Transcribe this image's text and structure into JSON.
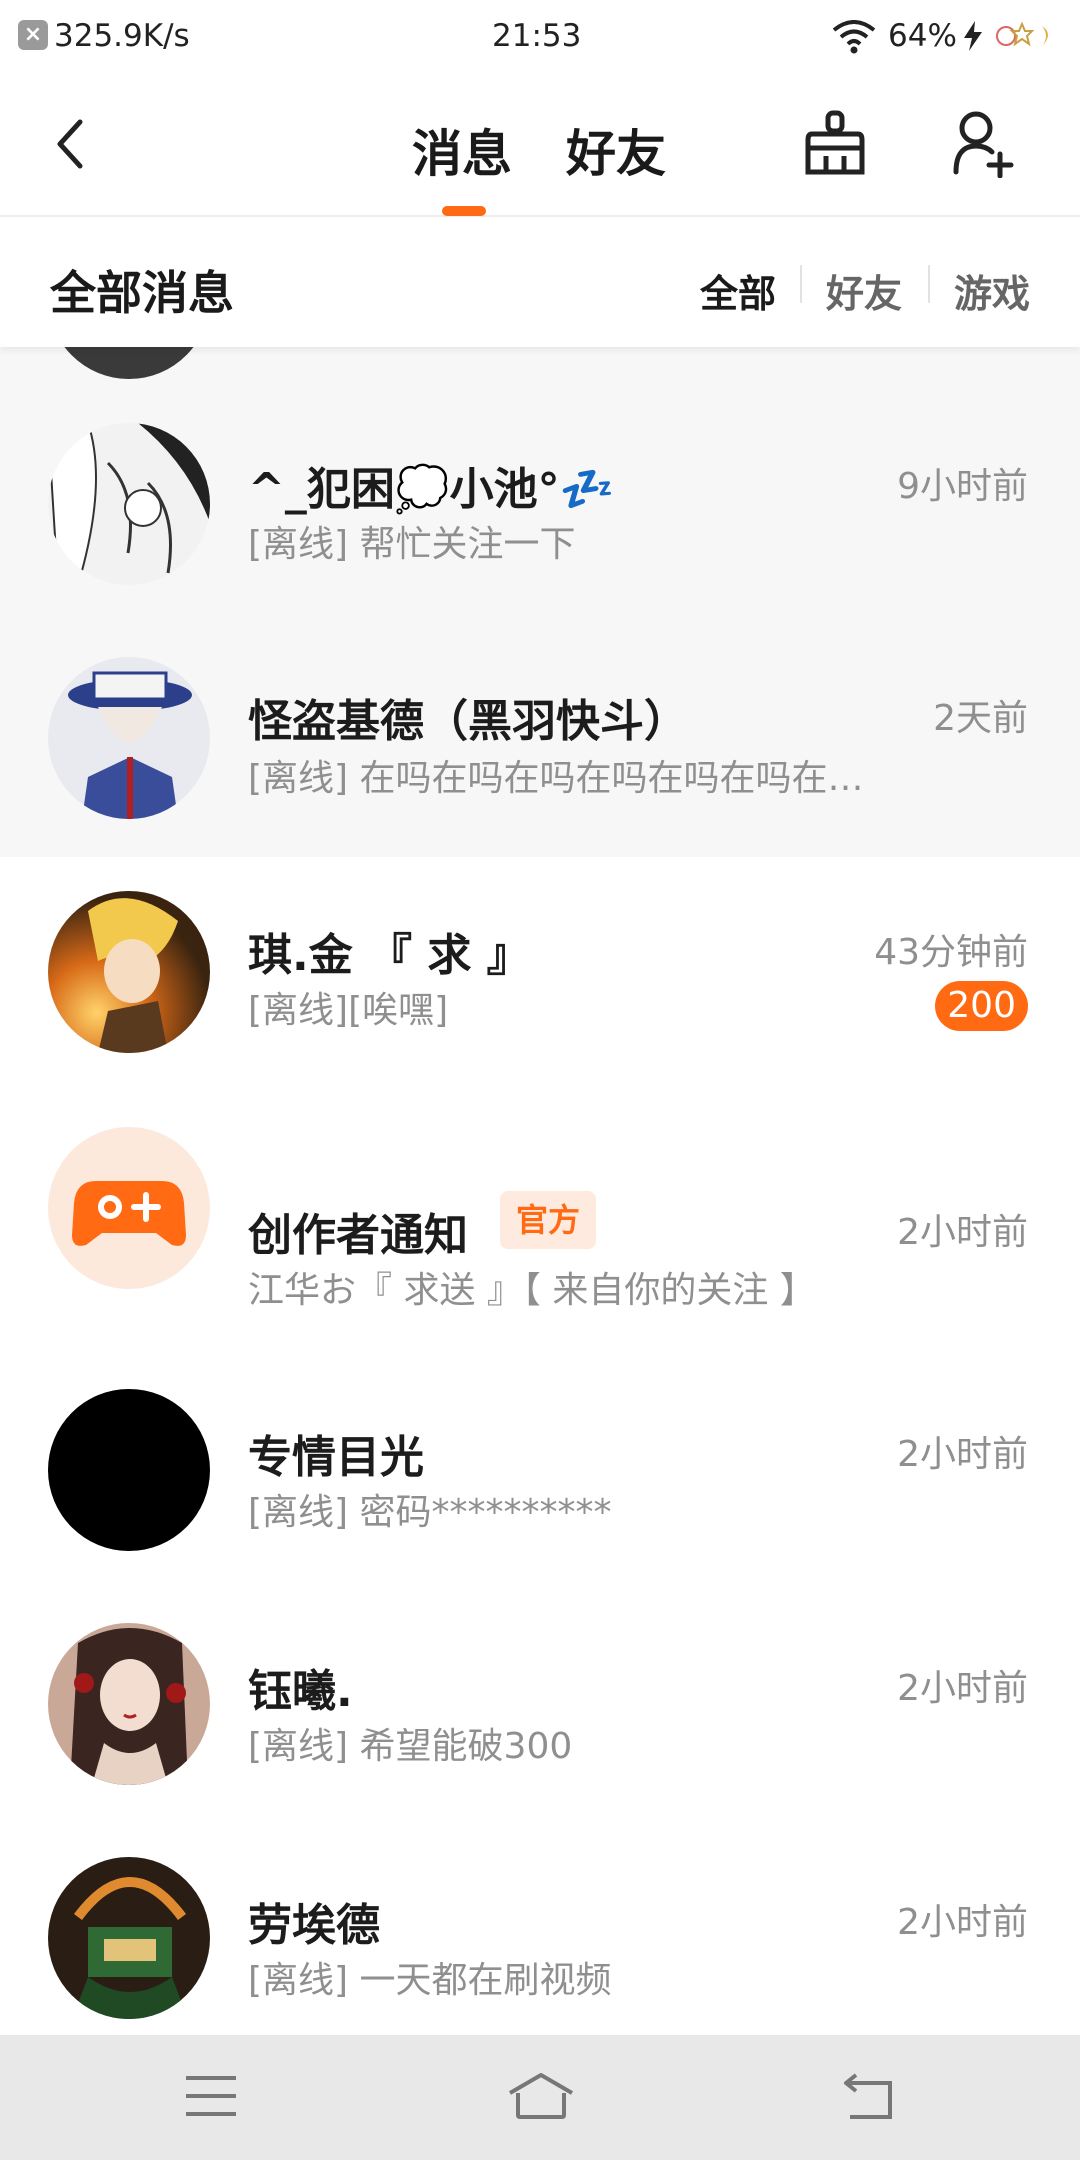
{
  "status_bar": {
    "speed": "325.9K/s",
    "time": "21:53",
    "battery": "64%",
    "icons": [
      "close-icon",
      "wifi-icon",
      "charging-icon",
      "sticker-icon"
    ]
  },
  "header": {
    "tabs": [
      {
        "label": "消息",
        "active": true
      },
      {
        "label": "好友",
        "active": false
      }
    ],
    "icons": [
      "back-icon",
      "broom-icon",
      "add-friend-icon"
    ],
    "accent_color": "#ff6a13"
  },
  "filter": {
    "title": "全部消息",
    "options": [
      "全部",
      "好友",
      "游戏"
    ],
    "selected": "全部"
  },
  "conversations": [
    {
      "name": "^_犯困💭小池°💤",
      "message": "[离线] 帮忙关注一下",
      "time": "9小时前",
      "highlighted": true
    },
    {
      "name": "怪盗基德（黑羽快斗）",
      "message": "[离线] 在吗在吗在吗在吗在吗在吗在…",
      "time": "2天前",
      "highlighted": true
    },
    {
      "name": "琪.金  『 求 』",
      "message": "[离线][唉嘿]",
      "time": "43分钟前",
      "badge": "200"
    },
    {
      "name": "创作者通知",
      "tag": "官方",
      "message": "江华お『 求送 』【 来自你的关注 】",
      "time": "2小时前"
    },
    {
      "name": "专情目光",
      "message": "[离线] 密码**********",
      "time": "2小时前"
    },
    {
      "name": "钰曦.",
      "message": "[离线] 希望能破300",
      "time": "2小时前"
    },
    {
      "name": "劳埃德",
      "message": "[离线] 一天都在刷视频",
      "time": "2小时前"
    }
  ],
  "nav_bar": {
    "icons": [
      "menu-icon",
      "home-icon",
      "back-nav-icon"
    ]
  }
}
